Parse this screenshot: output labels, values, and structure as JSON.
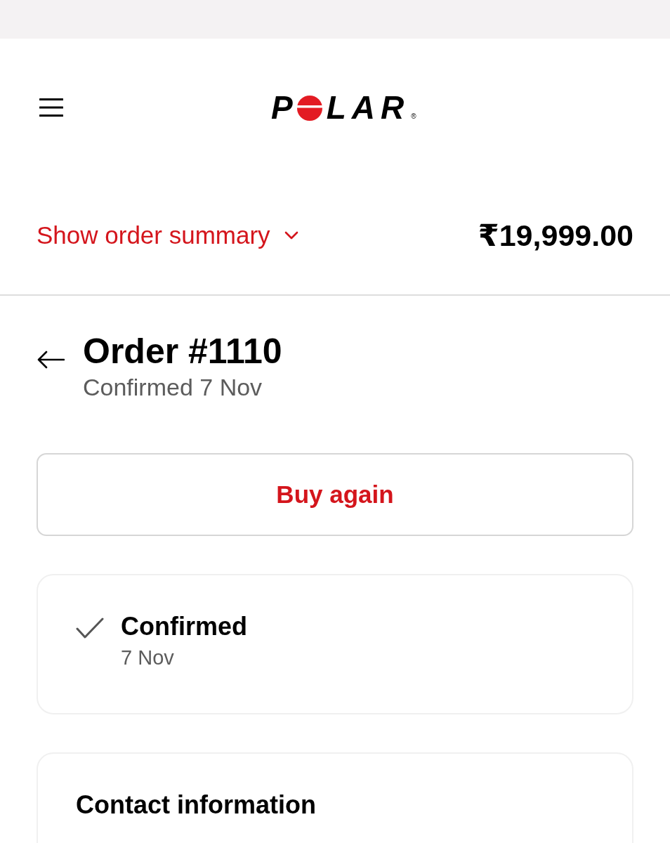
{
  "header": {
    "logo": {
      "lead": "P",
      "trail": "LAR",
      "registered": "®"
    }
  },
  "order_summary": {
    "label": "Show order summary",
    "expanded": false,
    "total": "₹19,999.00"
  },
  "order": {
    "title": "Order #1110",
    "subtitle": "Confirmed 7 Nov"
  },
  "buy_again": {
    "label": "Buy again"
  },
  "status": {
    "title": "Confirmed",
    "date": "7 Nov",
    "done": true
  },
  "contact": {
    "title": "Contact information"
  }
}
